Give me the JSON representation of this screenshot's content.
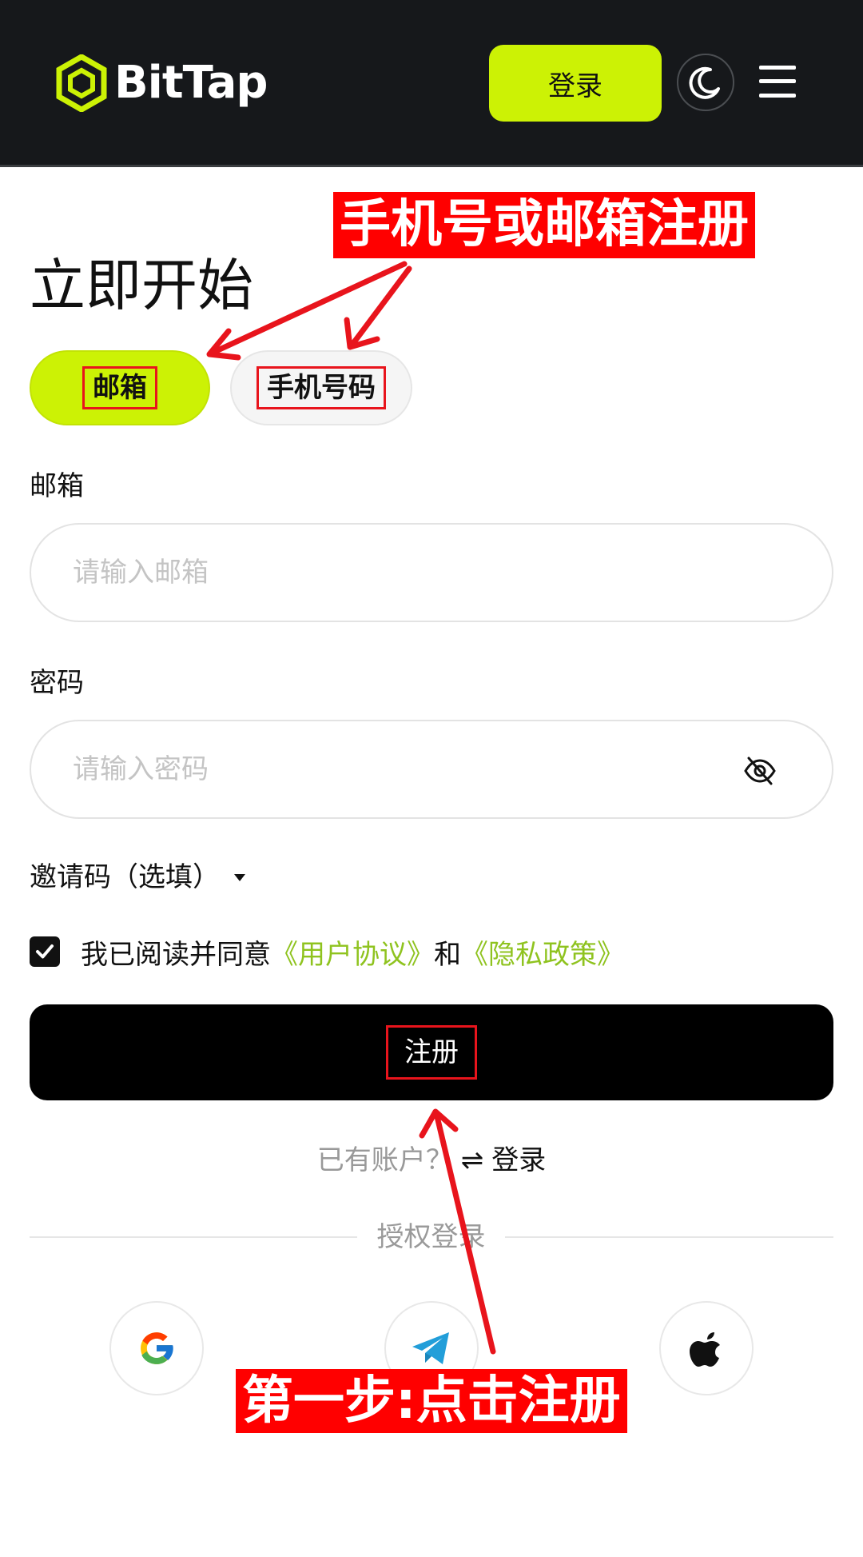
{
  "header": {
    "brand": "BitTap",
    "login_label": "登录",
    "theme_icon": "moon-icon",
    "menu_icon": "hamburger-menu-icon"
  },
  "page": {
    "title": "立即开始",
    "tabs": [
      {
        "label": "邮箱",
        "active": true
      },
      {
        "label": "手机号码",
        "active": false
      }
    ]
  },
  "form": {
    "email_label": "邮箱",
    "email_placeholder": "请输入邮箱",
    "email_value": "",
    "password_label": "密码",
    "password_placeholder": "请输入密码",
    "password_value": "",
    "invite_label": "邀请码（选填）",
    "agree_checked": true,
    "agree_prefix": "我已阅读并同意",
    "user_agreement": "《用户协议》",
    "agree_and": "和",
    "privacy_policy": "《隐私政策》",
    "register_label": "注册",
    "have_account": "已有账户？",
    "swap_symbol": "⇌",
    "login_link": "登录"
  },
  "oauth": {
    "divider_label": "授权登录",
    "providers": [
      "google-icon",
      "telegram-icon",
      "apple-icon"
    ]
  },
  "annotations": {
    "top": "手机号或邮箱注册",
    "bottom": "第一步:点击注册"
  },
  "colors": {
    "accent": "#ccf205",
    "header_bg": "#16181b",
    "link_green": "#8fc31f",
    "annotation_red": "#ff0000"
  }
}
